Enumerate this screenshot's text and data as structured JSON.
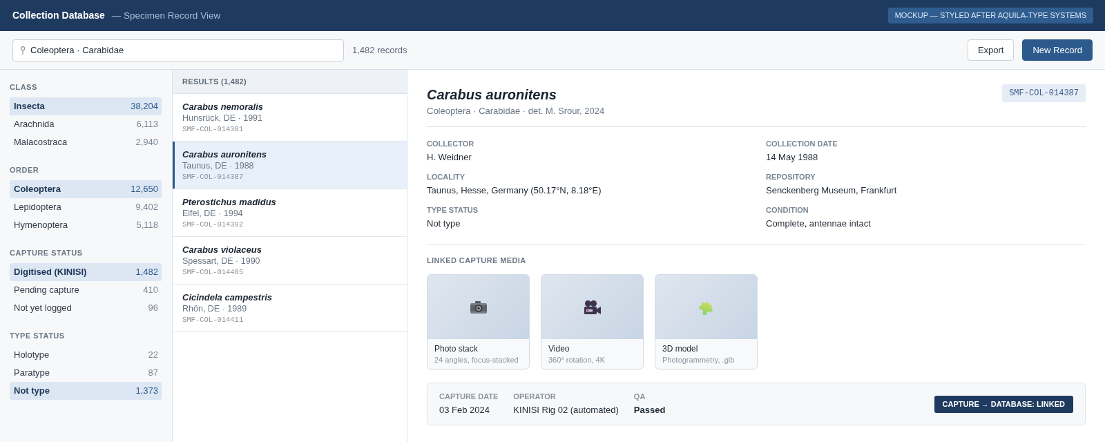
{
  "header": {
    "title": "Collection Database",
    "subtitle": "— Specimen Record View",
    "badge": "MOCKUP — STYLED AFTER AQUILA-TYPE SYSTEMS"
  },
  "toolbar": {
    "search": {
      "value": "Coleoptera · Carabidae"
    },
    "record_count": "1,482 records",
    "buttons": [
      {
        "label": "Export",
        "kind": "secondary"
      },
      {
        "label": "New Record",
        "kind": "primary"
      }
    ]
  },
  "filters": [
    {
      "heading": "CLASS",
      "items": [
        {
          "label": "Insecta",
          "count": "38,204",
          "selected": true
        },
        {
          "label": "Arachnida",
          "count": "6,113",
          "selected": false
        },
        {
          "label": "Malacostraca",
          "count": "2,940",
          "selected": false
        }
      ]
    },
    {
      "heading": "ORDER",
      "items": [
        {
          "label": "Coleoptera",
          "count": "12,650",
          "selected": true
        },
        {
          "label": "Lepidoptera",
          "count": "9,402",
          "selected": false
        },
        {
          "label": "Hymenoptera",
          "count": "5,118",
          "selected": false
        }
      ]
    },
    {
      "heading": "CAPTURE STATUS",
      "items": [
        {
          "label": "Digitised (KINISI)",
          "count": "1,482",
          "selected": true
        },
        {
          "label": "Pending capture",
          "count": "410",
          "selected": false
        },
        {
          "label": "Not yet logged",
          "count": "96",
          "selected": false
        }
      ]
    },
    {
      "heading": "TYPE STATUS",
      "items": [
        {
          "label": "Holotype",
          "count": "22",
          "selected": false
        },
        {
          "label": "Paratype",
          "count": "87",
          "selected": false
        },
        {
          "label": "Not type",
          "count": "1,373",
          "selected": true
        }
      ]
    }
  ],
  "results": {
    "heading": "RESULTS (1,482)",
    "items": [
      {
        "name": "Carabus nemoralis",
        "locality": "Hunsrück, DE · 1991",
        "catalog_number": "SMF-COL-014381",
        "selected": false
      },
      {
        "name": "Carabus auronitens",
        "locality": "Taunus, DE · 1988",
        "catalog_number": "SMF-COL-014387",
        "selected": true
      },
      {
        "name": "Pterostichus madidus",
        "locality": "Eifel, DE · 1994",
        "catalog_number": "SMF-COL-014392",
        "selected": false
      },
      {
        "name": "Carabus violaceus",
        "locality": "Spessart, DE · 1990",
        "catalog_number": "SMF-COL-014405",
        "selected": false
      },
      {
        "name": "Cicindela campestris",
        "locality": "Rhön, DE · 1989",
        "catalog_number": "SMF-COL-014411",
        "selected": false
      }
    ]
  },
  "record": {
    "title": "Carabus auronitens",
    "subtitle": "Coleoptera · Carabidae · det. M. Srour, 2024",
    "catalog_number": "SMF-COL-014387",
    "fields": [
      {
        "label": "COLLECTOR",
        "value": "H. Weidner"
      },
      {
        "label": "COLLECTION DATE",
        "value": "14 May 1988"
      },
      {
        "label": "LOCALITY",
        "value": "Taunus, Hesse, Germany (50.17°N, 8.18°E)"
      },
      {
        "label": "REPOSITORY",
        "value": "Senckenberg Museum, Frankfurt"
      },
      {
        "label": "TYPE STATUS",
        "value": "Not type"
      },
      {
        "label": "CONDITION",
        "value": "Complete, antennae intact"
      }
    ],
    "media_heading": "LINKED CAPTURE MEDIA",
    "media": [
      {
        "kind": "photo",
        "title": "Photo stack",
        "caption": "24 angles, focus-stacked"
      },
      {
        "kind": "video",
        "title": "Video",
        "caption": "360° rotation, 4K"
      },
      {
        "kind": "model",
        "title": "3D model",
        "caption": "Photogrammetry, .glb"
      }
    ],
    "capture": {
      "fields": [
        {
          "label": "CAPTURE DATE",
          "value": "03 Feb 2024",
          "kind": "text"
        },
        {
          "label": "OPERATOR",
          "value": "KINISI Rig 02 (automated)",
          "kind": "text"
        },
        {
          "label": "QA",
          "value": "Passed",
          "kind": "result"
        }
      ],
      "link_status": "CAPTURE → DATABASE: LINKED"
    }
  }
}
